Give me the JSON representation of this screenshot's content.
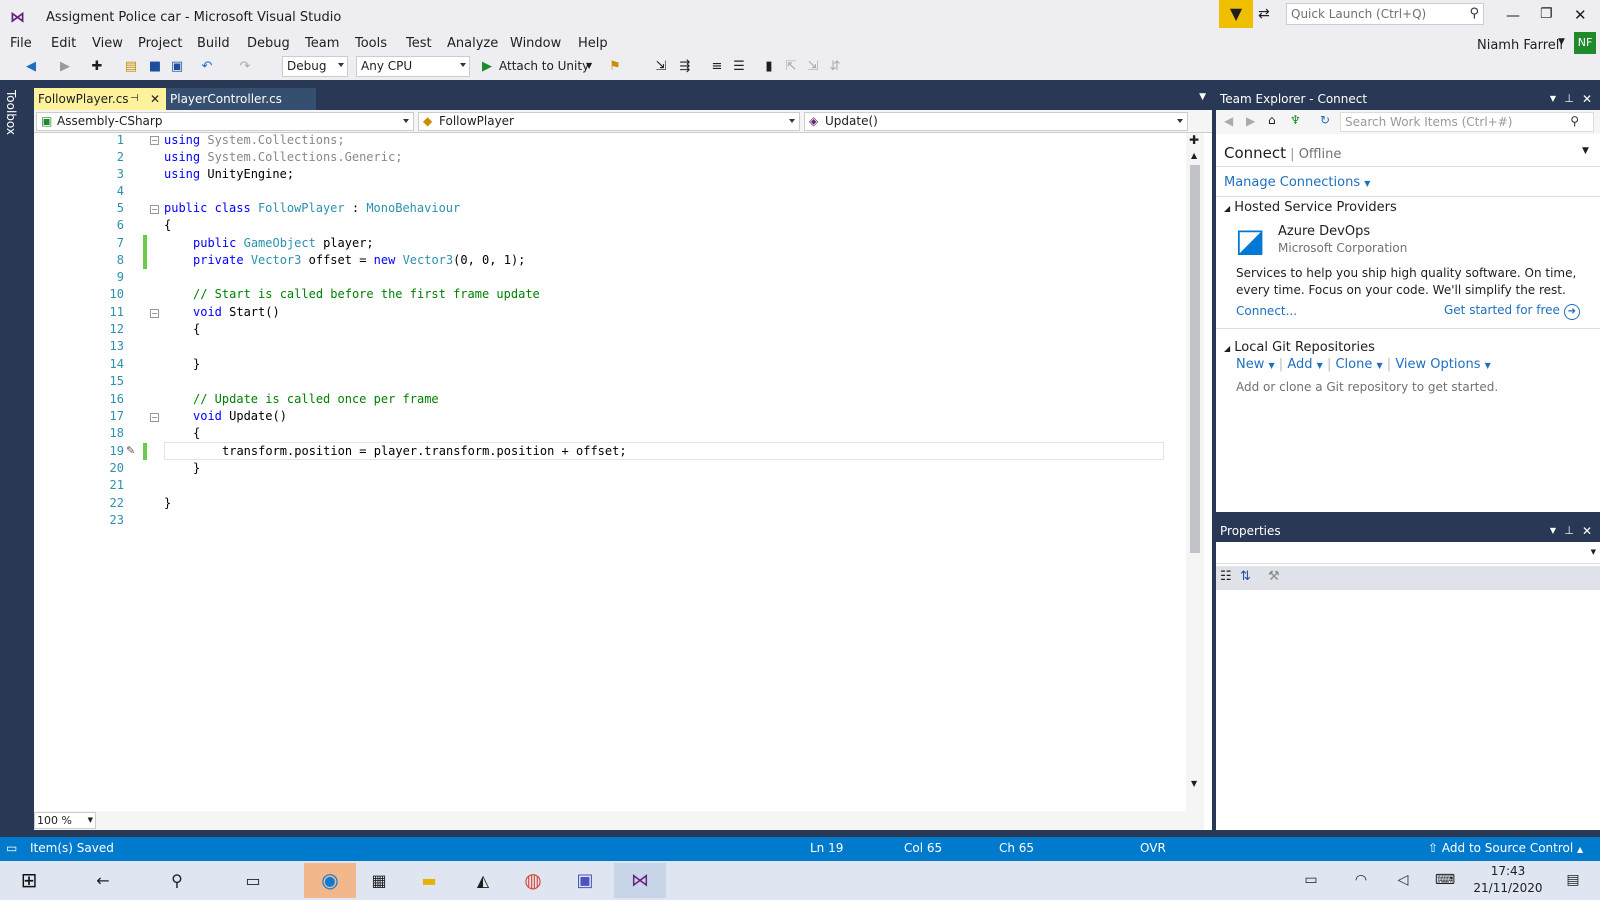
{
  "window": {
    "title": "Assigment Police car - Microsoft Visual Studio",
    "quick_launch_placeholder": "Quick Launch (Ctrl+Q)",
    "user_name": "Niamh Farrell",
    "user_initials": "NF"
  },
  "menu": [
    "File",
    "Edit",
    "View",
    "Project",
    "Build",
    "Debug",
    "Team",
    "Tools",
    "Test",
    "Analyze",
    "Window",
    "Help"
  ],
  "toolbar": {
    "config": "Debug",
    "platform": "Any CPU",
    "attach_label": "Attach to Unity"
  },
  "toolbox_label": "Toolbox",
  "tabs": [
    {
      "label": "FollowPlayer.cs",
      "active": true
    },
    {
      "label": "PlayerController.cs",
      "active": false
    }
  ],
  "nav": {
    "project": "Assembly-CSharp",
    "class": "FollowPlayer",
    "member": "Update()"
  },
  "code": {
    "line_numbers": [
      "1",
      "2",
      "3",
      "4",
      "5",
      "6",
      "7",
      "8",
      "9",
      "10",
      "11",
      "12",
      "13",
      "14",
      "15",
      "16",
      "17",
      "18",
      "19",
      "20",
      "21",
      "22",
      "23"
    ],
    "l1_kw": "using",
    "l1_rest": " System.Collections;",
    "l2_kw": "using",
    "l2_rest": " System.Collections.Generic;",
    "l3_kw": "using",
    "l3_rest": " UnityEngine;",
    "l5_kw": "public class",
    "l5_ty": "FollowPlayer",
    "l5_sep": " : ",
    "l5_base": "MonoBehaviour",
    "l6": "{",
    "l7_kw": "public",
    "l7_ty": "GameObject",
    "l7_rest": " player;",
    "l8_kw": "private",
    "l8_ty": "Vector3",
    "l8_mid": " offset = ",
    "l8_kw2": "new",
    "l8_ty2": "Vector3",
    "l8_rest": "(0, 0, 1);",
    "l10": "// Start is called before the first frame update",
    "l11_kw": "void",
    "l11_rest": " Start()",
    "l12": "{",
    "l14": "}",
    "l16": "// Update is called once per frame",
    "l17_kw": "void",
    "l17_rest": " Update()",
    "l18": "{",
    "l19": "transform.position = player.transform.position + offset;",
    "l20": "}",
    "l22": "}"
  },
  "zoom": "100 %",
  "team_explorer": {
    "title": "Team Explorer - Connect",
    "search_placeholder": "Search Work Items (Ctrl+#)",
    "connect": "Connect",
    "offline": "Offline",
    "manage": "Manage Connections",
    "hosted": "Hosted Service Providers",
    "azure": "Azure DevOps",
    "ms": "Microsoft Corporation",
    "desc": "Services to help you ship high quality software. On time, every time. Focus on your code. We'll simplify the rest.",
    "connect_link": "Connect...",
    "started": "Get started for free",
    "local_git": "Local Git Repositories",
    "git_actions": [
      "New",
      "Add",
      "Clone",
      "View Options"
    ],
    "git_hint": "Add or clone a Git repository to get started."
  },
  "properties_title": "Properties",
  "status": {
    "left": "Item(s) Saved",
    "ln": "Ln 19",
    "col": "Col 65",
    "ch": "Ch 65",
    "ovr": "OVR",
    "source_control": "Add to Source Control"
  },
  "clock": {
    "time": "17:43",
    "date": "21/11/2020"
  },
  "colors": {
    "accent": "#007acc",
    "dark": "#293955",
    "vs_purple": "#68217a"
  }
}
